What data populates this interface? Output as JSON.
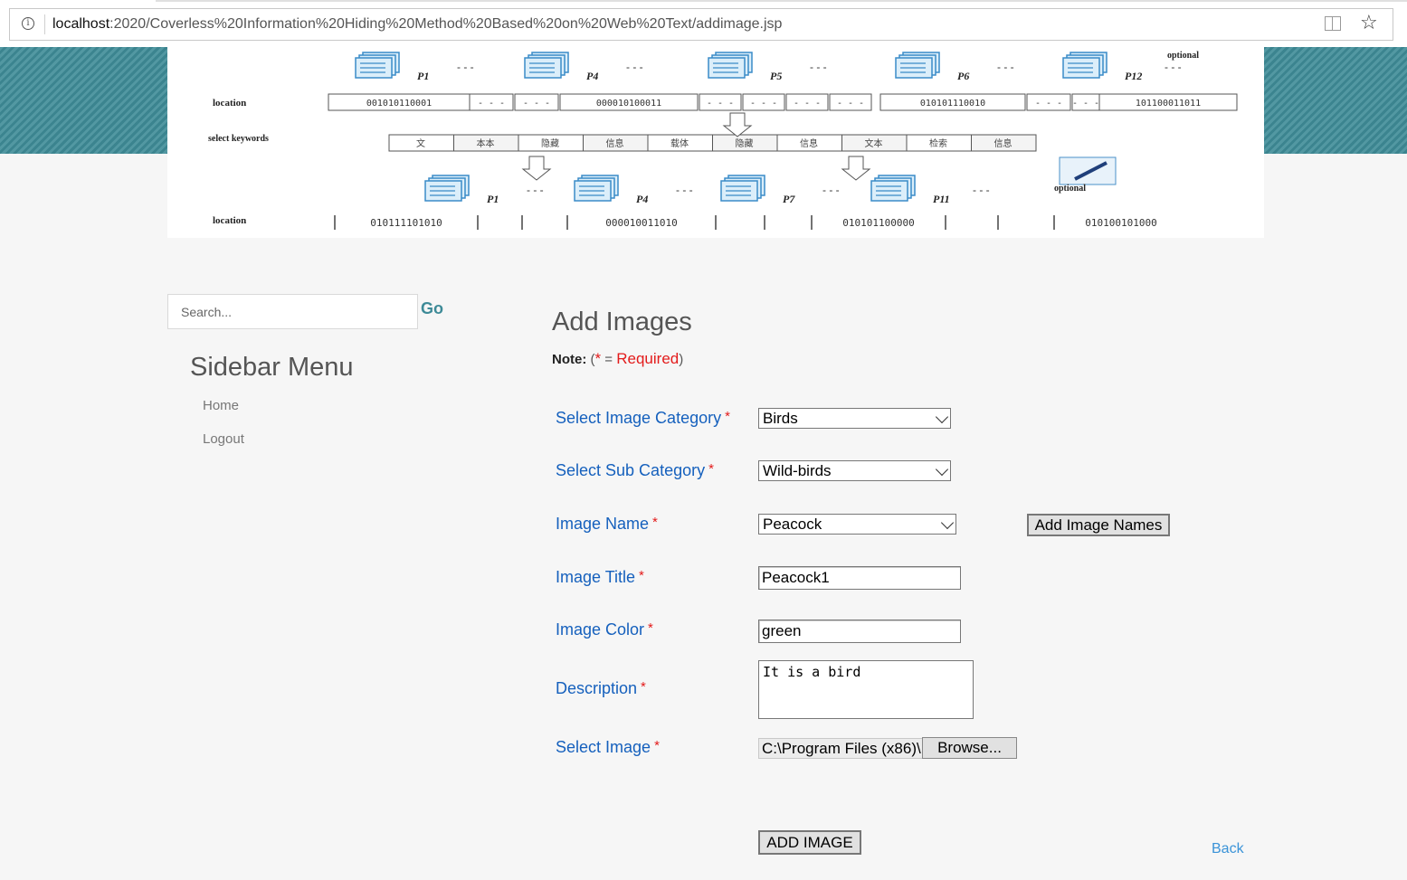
{
  "browser": {
    "url_host": "localhost",
    "url_rest": ":2020/Coverless%20Information%20Hiding%20Method%20Based%20on%20Web%20Text/addimage.jsp",
    "info_icon": "info-icon",
    "reader_icon": "reading-view-icon",
    "favorite_icon": "star-icon"
  },
  "banner": {
    "row1_label": "location",
    "row2_label": "select keywords",
    "row3_label": "location",
    "optional_label": "optional",
    "row1_codes": [
      "001010110001",
      "000010100011",
      "010101110010",
      "101100011011"
    ],
    "row3_codes": [
      "010111101010",
      "000010011010",
      "010101100000",
      "010100101000"
    ],
    "doc_labels_top": [
      "P1",
      "P4",
      "P5",
      "P6",
      "P12"
    ],
    "doc_labels_bottom": [
      "P1",
      "P4",
      "P7",
      "P11"
    ],
    "keywords": [
      "文",
      "本本",
      "隐藏",
      "信息",
      "载体",
      "隐藏",
      "信息",
      "文本",
      "检索",
      "信息"
    ]
  },
  "sidebar": {
    "search_placeholder": "Search...",
    "go_label": "Go",
    "title": "Sidebar Menu",
    "links": [
      {
        "label": "Home"
      },
      {
        "label": "Logout"
      }
    ]
  },
  "main": {
    "title": "Add Images",
    "note_label": "Note:",
    "note_open": "(",
    "note_star": "*",
    "note_equals": "=",
    "note_required": "Required",
    "note_close": ")",
    "fields": {
      "category": {
        "label": "Select Image Category",
        "star": "*",
        "value": "Birds"
      },
      "subcategory": {
        "label": "Select Sub Category",
        "star": "*",
        "value": "Wild-birds"
      },
      "image_name": {
        "label": "Image Name",
        "star": "*",
        "value": "Peacock"
      },
      "image_title": {
        "label": "Image Title",
        "star": "*",
        "value": "Peacock1"
      },
      "image_color": {
        "label": "Image Color",
        "star": "*",
        "value": "green"
      },
      "description": {
        "label": "Description",
        "star": "*",
        "value": "It is a bird"
      },
      "select_image": {
        "label": "Select Image",
        "star": "*",
        "value": "C:\\Program Files (x86)\\"
      }
    },
    "add_image_names_label": "Add Image Names",
    "browse_label": "Browse...",
    "submit_label": "ADD IMAGE",
    "back_label": "Back"
  },
  "colors": {
    "header_teal": "#3f8c98",
    "label_blue": "#1560bd",
    "required_red": "#e31b1b",
    "link_blue": "#3a93d8"
  }
}
